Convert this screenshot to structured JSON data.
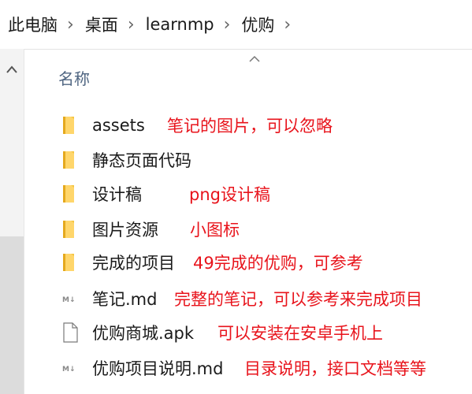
{
  "breadcrumb": {
    "items": [
      "此电脑",
      "桌面",
      "learnmp",
      "优购"
    ],
    "separator": ">"
  },
  "column_header": {
    "name_label": "名称",
    "sort_indicator": "^"
  },
  "nav_pane": {
    "scroll_up_glyph": "^"
  },
  "colors": {
    "annotation": "#e8131b",
    "folder": "#f5c542",
    "header_text": "#4f6581"
  },
  "files": [
    {
      "name": "assets",
      "type": "folder",
      "icon": "folder-icon",
      "note": "笔记的图片，可以忽略"
    },
    {
      "name": "静态页面代码",
      "type": "folder",
      "icon": "folder-icon",
      "note": ""
    },
    {
      "name": "设计稿",
      "type": "folder",
      "icon": "folder-icon",
      "note": "png设计稿"
    },
    {
      "name": "图片资源",
      "type": "folder",
      "icon": "folder-icon",
      "note": "小图标"
    },
    {
      "name": "完成的项目",
      "type": "folder",
      "icon": "folder-icon",
      "note": "49完成的优购，可参考"
    },
    {
      "name": "笔记.md",
      "type": "markdown",
      "icon": "markdown-file-icon",
      "note": "完整的笔记，可以参考来完成项目"
    },
    {
      "name": "优购商城.apk",
      "type": "file",
      "icon": "blank-file-icon",
      "note": "可以安装在安卓手机上"
    },
    {
      "name": "优购项目说明.md",
      "type": "markdown",
      "icon": "markdown-file-icon",
      "note": "目录说明，接口文档等等"
    }
  ]
}
